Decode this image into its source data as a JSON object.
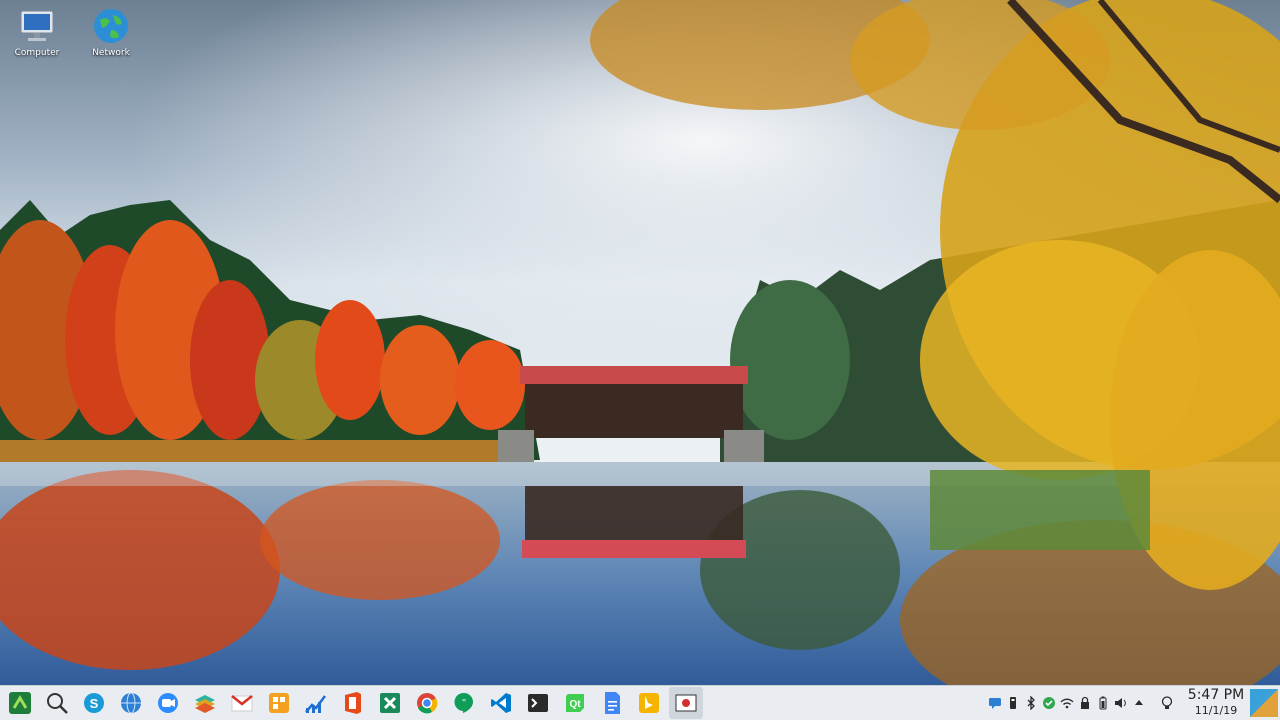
{
  "desktop_icons": [
    {
      "label": "Computer",
      "icon": "computer-icon"
    },
    {
      "label": "Network",
      "icon": "network-globe-icon"
    }
  ],
  "taskbar": {
    "apps": [
      {
        "name": "start-menu",
        "icon": "start-icon",
        "color": "#1e7d3a",
        "active": false
      },
      {
        "name": "search",
        "icon": "search-icon",
        "color": "#333333",
        "active": false
      },
      {
        "name": "skype",
        "icon": "skype-icon",
        "color": "#1a9ad6",
        "active": false
      },
      {
        "name": "browser-globe",
        "icon": "globe-icon",
        "color": "#2d7fd1",
        "active": false
      },
      {
        "name": "zoom",
        "icon": "zoom-icon",
        "color": "#2d8cff",
        "active": false
      },
      {
        "name": "stacks",
        "icon": "layers-icon",
        "color": "#e0a020",
        "active": false
      },
      {
        "name": "gmail",
        "icon": "gmail-icon",
        "color": "#d93025",
        "active": false
      },
      {
        "name": "orange-grid",
        "icon": "grid-icon",
        "color": "#f4a020",
        "active": false
      },
      {
        "name": "chart-app",
        "icon": "chart-icon",
        "color": "#1f6fd1",
        "active": false
      },
      {
        "name": "office",
        "icon": "office-icon",
        "color": "#e64a19",
        "active": false
      },
      {
        "name": "xmind",
        "icon": "x-tool-icon",
        "color": "#1b8a5a",
        "active": false
      },
      {
        "name": "chrome",
        "icon": "chrome-icon",
        "color": "#4285f4",
        "active": false
      },
      {
        "name": "hangouts",
        "icon": "hangouts-icon",
        "color": "#0f9d58",
        "active": false
      },
      {
        "name": "vscode",
        "icon": "vscode-icon",
        "color": "#007acc",
        "active": false
      },
      {
        "name": "terminal",
        "icon": "terminal-icon",
        "color": "#2b2b2b",
        "active": false
      },
      {
        "name": "qt-app",
        "icon": "qt-icon",
        "color": "#41cd52",
        "active": false
      },
      {
        "name": "docs",
        "icon": "docs-icon",
        "color": "#4285f4",
        "active": false
      },
      {
        "name": "bing",
        "icon": "bing-icon",
        "color": "#f4b400",
        "active": false
      },
      {
        "name": "screen-recorder",
        "icon": "record-icon",
        "color": "#d32f2f",
        "active": true
      }
    ],
    "tray": [
      "chat-icon",
      "usb-icon",
      "bluetooth-icon",
      "check-icon",
      "wifi-icon",
      "lock-icon",
      "battery-icon",
      "volume-icon",
      "arrow-up-icon",
      "lightbulb-icon"
    ],
    "clock": {
      "time": "5:47 PM",
      "date": "11/1/19"
    }
  }
}
